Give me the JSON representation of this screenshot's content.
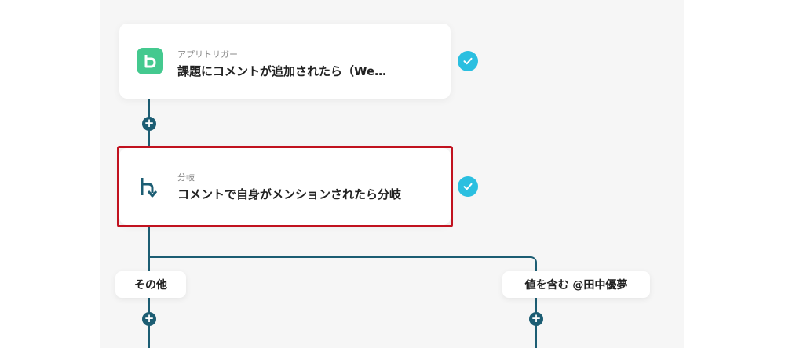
{
  "trigger": {
    "subtitle": "アプリトリガー",
    "title": "課題にコメントが追加されたら（We…",
    "icon": "backlog-app-icon",
    "status_icon": "check-icon"
  },
  "branch_step": {
    "subtitle": "分岐",
    "title": "コメントで自身がメンションされたら分岐",
    "icon": "branch-icon",
    "status_icon": "check-icon"
  },
  "branches": {
    "left_label": "その他",
    "right_label": "値を含む @田中優夢"
  },
  "add_step_icon": "plus-icon",
  "colors": {
    "connector": "#1c5d73",
    "check": "#2bbfe0",
    "app_icon": "#44c98f",
    "highlight": "#c1121f",
    "canvas": "#f6f6f6"
  }
}
